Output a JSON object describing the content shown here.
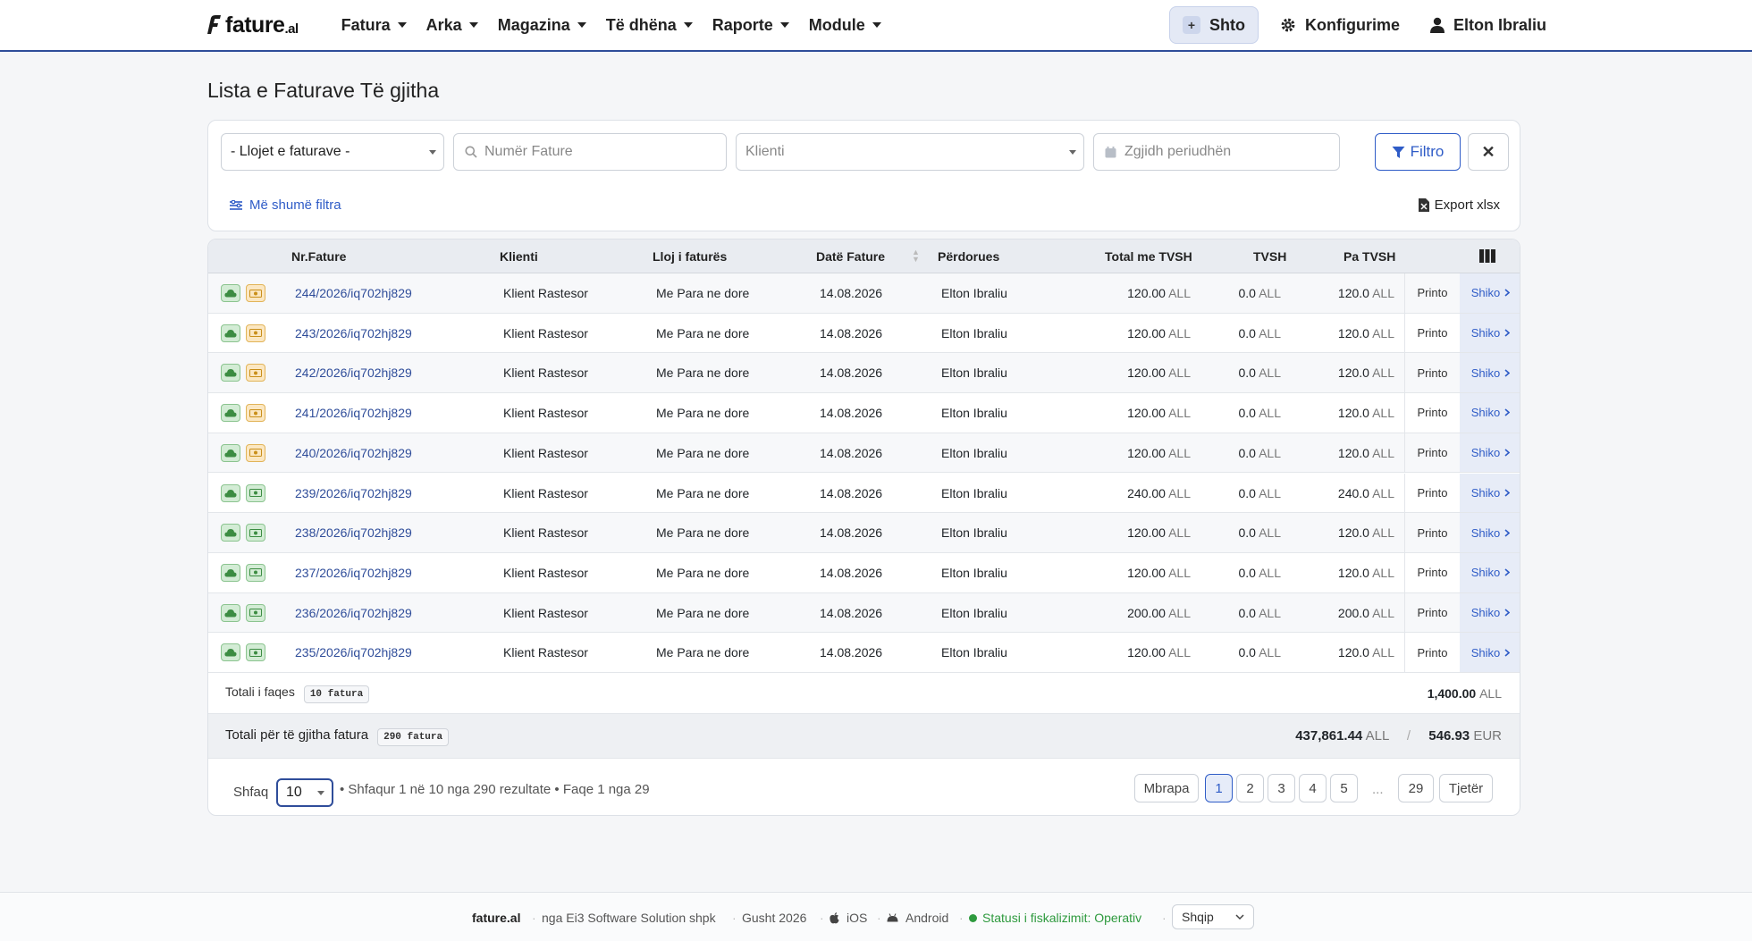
{
  "navbar": {
    "logo_text": "fature",
    "logo_suffix": ".al",
    "menus": [
      "Fatura",
      "Arka",
      "Magazina",
      "Të dhëna",
      "Raporte",
      "Module"
    ],
    "add_button": "Shto",
    "config_link": "Konfigurime",
    "user_link": "Elton Ibraliu",
    "accent_color": "#2f4d9a"
  },
  "page": {
    "title": "Lista e Faturave Të gjitha"
  },
  "filters": {
    "invoice_type": "- Llojet e faturave -",
    "invoice_number_placeholder": "Numër Fature",
    "client_placeholder": "Klienti",
    "period_placeholder": "Zgjidh periudhën",
    "filter_button": "Filtro",
    "clear_button": "✕",
    "more_filters": "Më shumë filtra",
    "export": "Export xlsx"
  },
  "table": {
    "headers": {
      "number": "Nr.Fature",
      "client": "Klienti",
      "type": "Lloj i faturës",
      "date": "Datë Fature",
      "user": "Përdorues",
      "total_vat": "Total me TVSH",
      "vat": "TVSH",
      "no_vat": "Pa TVSH"
    },
    "currency": "ALL",
    "print_label": "Printo",
    "view_label": "Shiko",
    "rows": [
      {
        "number": "244/2026/iq702hj829",
        "client": "Klient Rastesor",
        "type": "Me Para ne dore",
        "date": "14.08.2026",
        "user": "Elton Ibraliu",
        "total": "120.00",
        "vat": "0.0",
        "net": "120.0",
        "payment_icon": "orange"
      },
      {
        "number": "243/2026/iq702hj829",
        "client": "Klient Rastesor",
        "type": "Me Para ne dore",
        "date": "14.08.2026",
        "user": "Elton Ibraliu",
        "total": "120.00",
        "vat": "0.0",
        "net": "120.0",
        "payment_icon": "orange"
      },
      {
        "number": "242/2026/iq702hj829",
        "client": "Klient Rastesor",
        "type": "Me Para ne dore",
        "date": "14.08.2026",
        "user": "Elton Ibraliu",
        "total": "120.00",
        "vat": "0.0",
        "net": "120.0",
        "payment_icon": "orange"
      },
      {
        "number": "241/2026/iq702hj829",
        "client": "Klient Rastesor",
        "type": "Me Para ne dore",
        "date": "14.08.2026",
        "user": "Elton Ibraliu",
        "total": "120.00",
        "vat": "0.0",
        "net": "120.0",
        "payment_icon": "orange"
      },
      {
        "number": "240/2026/iq702hj829",
        "client": "Klient Rastesor",
        "type": "Me Para ne dore",
        "date": "14.08.2026",
        "user": "Elton Ibraliu",
        "total": "120.00",
        "vat": "0.0",
        "net": "120.0",
        "payment_icon": "orange"
      },
      {
        "number": "239/2026/iq702hj829",
        "client": "Klient Rastesor",
        "type": "Me Para ne dore",
        "date": "14.08.2026",
        "user": "Elton Ibraliu",
        "total": "240.00",
        "vat": "0.0",
        "net": "240.0",
        "payment_icon": "green"
      },
      {
        "number": "238/2026/iq702hj829",
        "client": "Klient Rastesor",
        "type": "Me Para ne dore",
        "date": "14.08.2026",
        "user": "Elton Ibraliu",
        "total": "120.00",
        "vat": "0.0",
        "net": "120.0",
        "payment_icon": "green"
      },
      {
        "number": "237/2026/iq702hj829",
        "client": "Klient Rastesor",
        "type": "Me Para ne dore",
        "date": "14.08.2026",
        "user": "Elton Ibraliu",
        "total": "120.00",
        "vat": "0.0",
        "net": "120.0",
        "payment_icon": "green"
      },
      {
        "number": "236/2026/iq702hj829",
        "client": "Klient Rastesor",
        "type": "Me Para ne dore",
        "date": "14.08.2026",
        "user": "Elton Ibraliu",
        "total": "200.00",
        "vat": "0.0",
        "net": "200.0",
        "payment_icon": "green"
      },
      {
        "number": "235/2026/iq702hj829",
        "client": "Klient Rastesor",
        "type": "Me Para ne dore",
        "date": "14.08.2026",
        "user": "Elton Ibraliu",
        "total": "120.00",
        "vat": "0.0",
        "net": "120.0",
        "payment_icon": "green"
      }
    ],
    "page_total_label": "Totali i faqes",
    "page_total_badge": "10 fatura",
    "page_total_value": "1,400.00",
    "all_total_label": "Totali për të gjitha fatura",
    "all_total_badge": "290 fatura",
    "all_total_all": "437,861.44",
    "all_total_all_currency": "ALL",
    "all_total_separator": "/",
    "all_total_eur": "546.93",
    "all_total_eur_currency": "EUR"
  },
  "pagination": {
    "show_label": "Shfaq",
    "per_page": "10",
    "summary": "• Shfaqur 1 në 10 nga 290 rezultate • Faqe 1 nga 29",
    "prev": "Mbrapa",
    "pages": [
      "1",
      "2",
      "3",
      "4",
      "5"
    ],
    "ellipsis": "...",
    "last_page": "29",
    "next": "Tjetër",
    "current_page": "1"
  },
  "footer": {
    "brand": "fature.al",
    "company": "nga Ei3 Software Solution shpk",
    "date": "Gusht 2026",
    "ios": "iOS",
    "android": "Android",
    "status": "Statusi i fiskalizimit: Operativ",
    "status_color": "#2e9a3e",
    "language": "Shqip"
  }
}
